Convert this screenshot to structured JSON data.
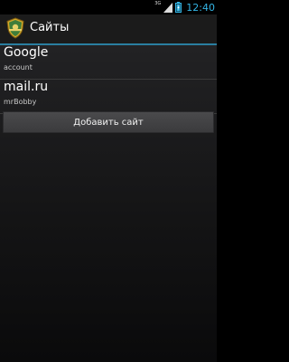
{
  "status_bar": {
    "network_label": "3G",
    "clock": "12:40",
    "battery_color": "#33b5e5",
    "signal_color": "#dddddd"
  },
  "action_bar": {
    "title": "Сайты",
    "icon": "shield-app-icon",
    "accent_color": "#2a7ea0"
  },
  "sites": [
    {
      "name": "Google",
      "account": "account"
    },
    {
      "name": "mail.ru",
      "account": "mrBobby"
    }
  ],
  "add_button": {
    "label": "Добавить сайт"
  }
}
